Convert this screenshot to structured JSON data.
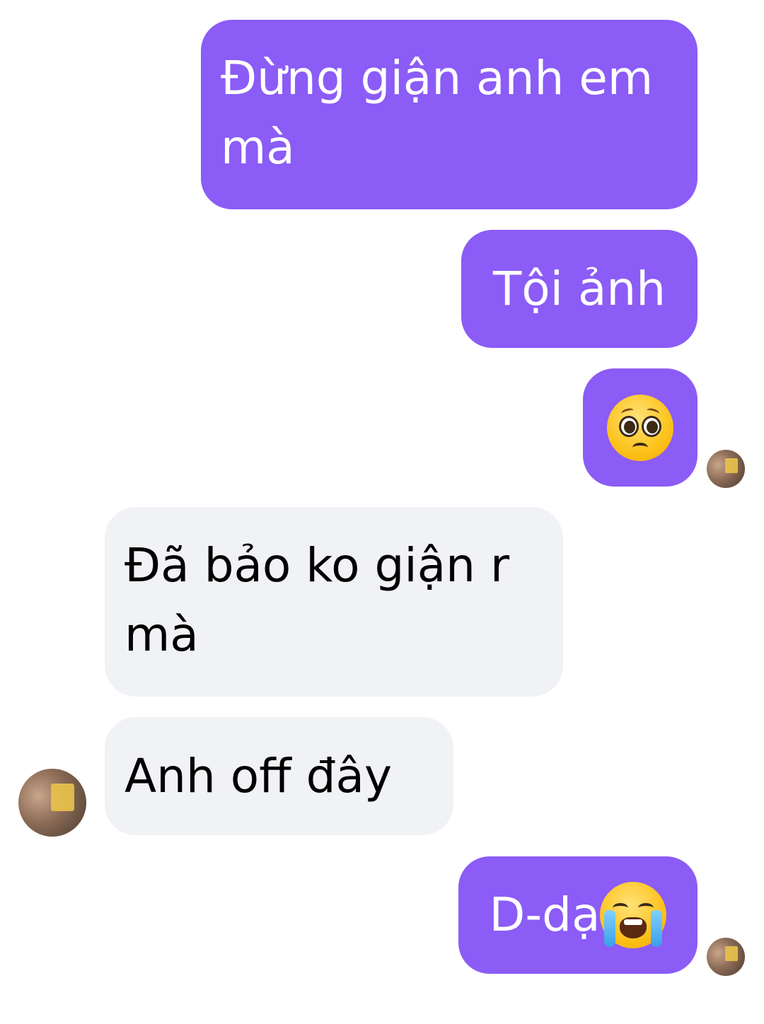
{
  "messages": [
    {
      "id": "b1",
      "direction": "outgoing",
      "text": "Đừng giận anh em mà"
    },
    {
      "id": "b2",
      "direction": "outgoing",
      "text": "Tội ảnh"
    },
    {
      "id": "b3",
      "direction": "outgoing",
      "text": "",
      "emoji": "pleading-face"
    },
    {
      "id": "b4",
      "direction": "incoming",
      "text": "Đã bảo ko giận r mà"
    },
    {
      "id": "b5",
      "direction": "incoming",
      "text": "Anh off đây"
    },
    {
      "id": "b6",
      "direction": "outgoing",
      "text": "D-dạ",
      "emoji": "loudly-crying-face"
    }
  ],
  "colors": {
    "outgoing_bubble": "#8b5cf6",
    "incoming_bubble": "#f1f2f5",
    "outgoing_text": "#ffffff",
    "incoming_text": "#000000",
    "background": "#ffffff"
  },
  "avatars": {
    "self": "read-receipt-avatar",
    "contact": "contact-avatar"
  }
}
